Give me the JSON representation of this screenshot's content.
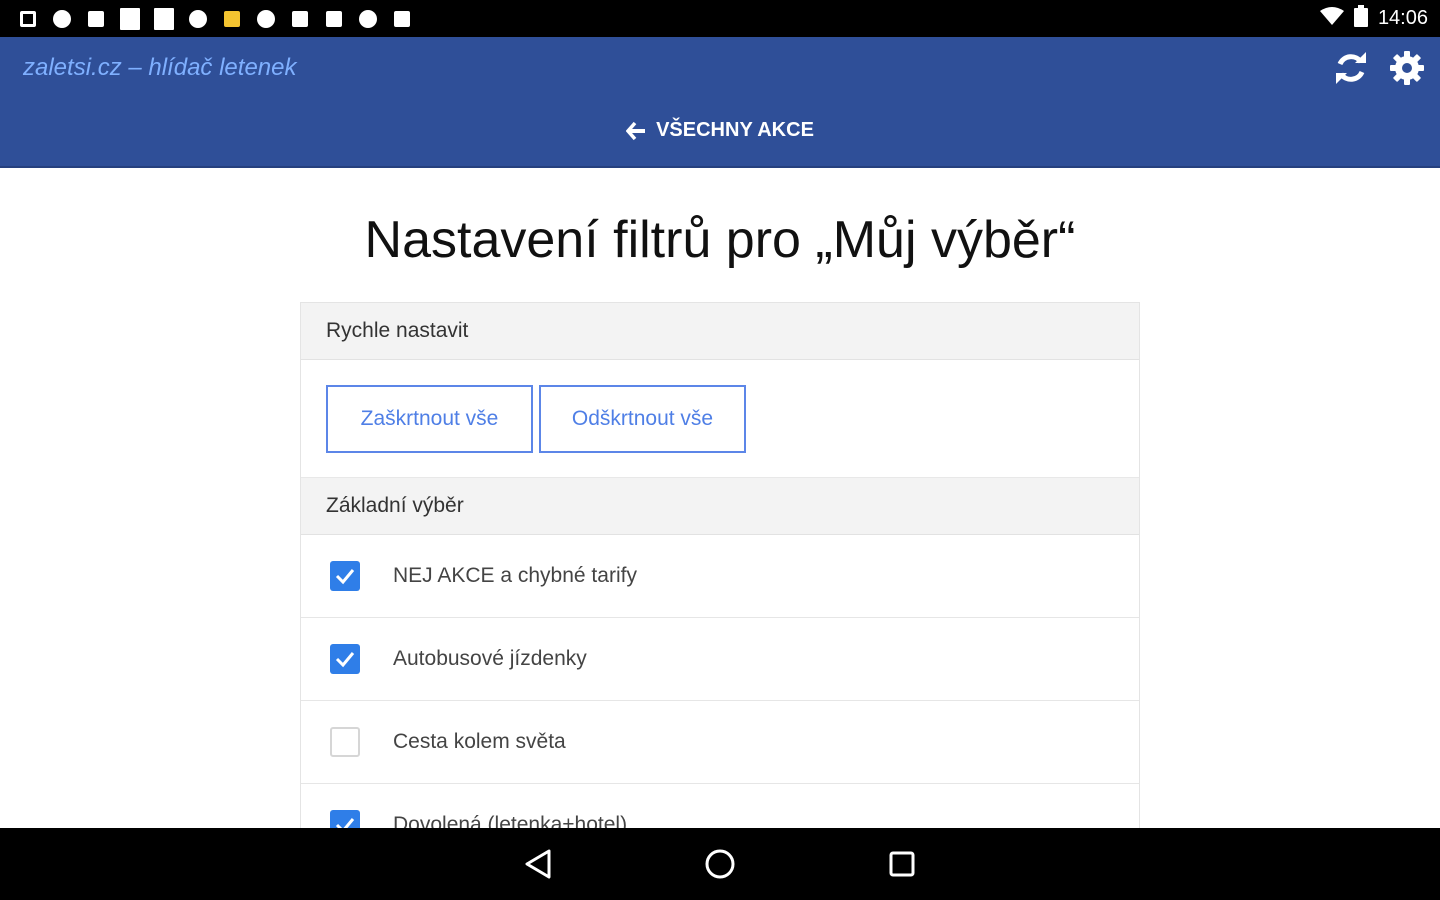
{
  "status_bar": {
    "notification_icons": [
      "notification-icon",
      "skype-icon",
      "screen-icon",
      "mail-icon",
      "square-icon",
      "chrome-icon",
      "files-icon",
      "android-icon",
      "gallery-icon",
      "sim-icon",
      "android-icon",
      "photo-icon"
    ],
    "time": "14:06",
    "right_icons": [
      "wifi-icon",
      "battery-icon"
    ]
  },
  "header": {
    "app_title": "zaletsi.cz – hlídač letenek",
    "back_label": "VŠECHNY AKCE",
    "icons": [
      "refresh-icon",
      "gear-icon"
    ],
    "bg_color": "#2f4f98",
    "title_color": "#7fb0ff"
  },
  "main": {
    "page_title": "Nastavení filtrů pro „Můj výběr“",
    "quick": {
      "heading": "Rychle nastavit",
      "check_all_label": "Zaškrtnout vše",
      "uncheck_all_label": "Odškrtnout vše"
    },
    "basic": {
      "heading": "Základní výběr",
      "items": [
        {
          "label": "NEJ AKCE a chybné tarify",
          "checked": true
        },
        {
          "label": "Autobusové jízdenky",
          "checked": true
        },
        {
          "label": "Cesta kolem světa",
          "checked": false
        },
        {
          "label": "Dovolená (letenka+hotel)",
          "checked": true
        }
      ]
    },
    "accent_color": "#2f7ee8"
  },
  "nav_bar": {
    "icons": [
      "back-icon",
      "home-icon",
      "recents-icon"
    ]
  }
}
